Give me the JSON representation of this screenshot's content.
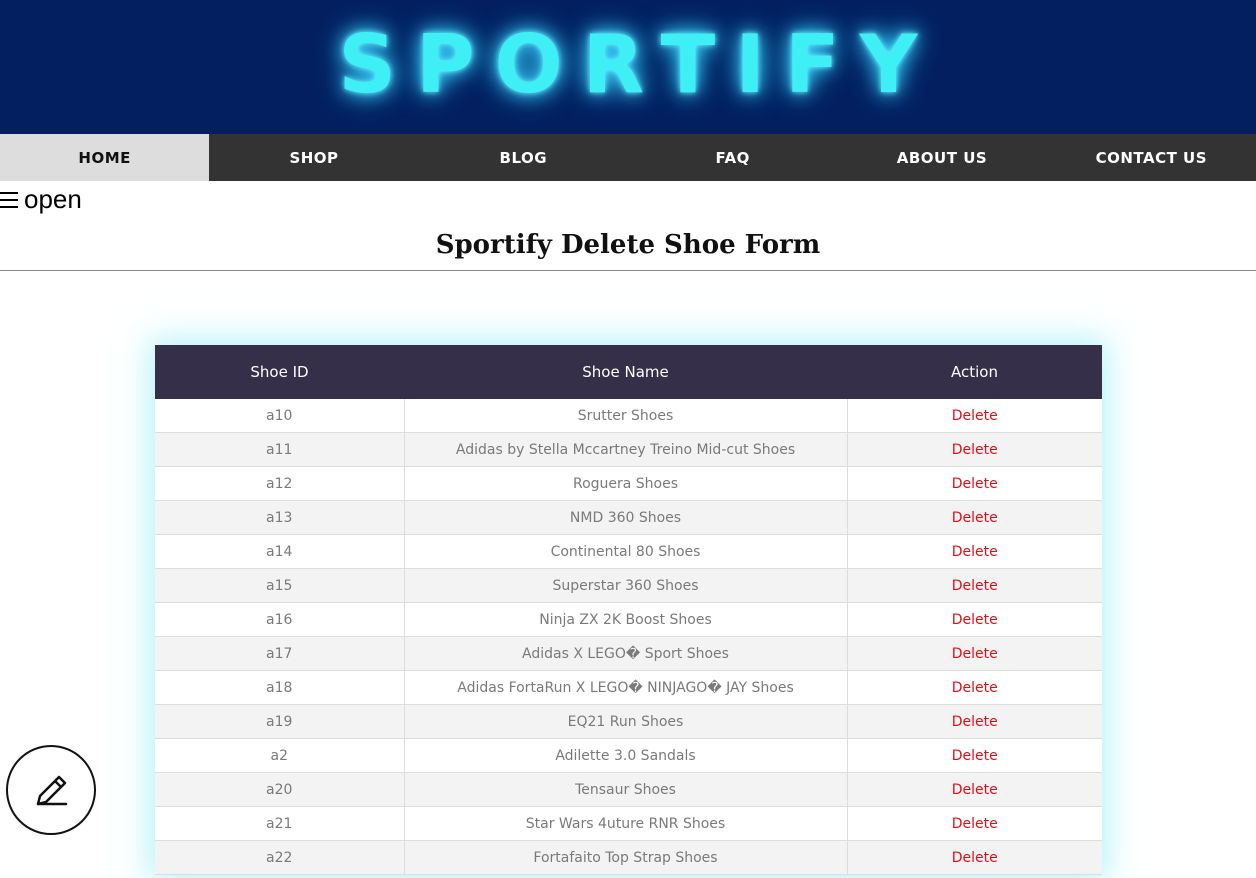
{
  "brand": {
    "logo_text": "SPORTIFY"
  },
  "nav": {
    "items": [
      {
        "label": "HOME",
        "active": true
      },
      {
        "label": "SHOP"
      },
      {
        "label": "BLOG"
      },
      {
        "label": "FAQ"
      },
      {
        "label": "ABOUT US"
      },
      {
        "label": "CONTACT US"
      }
    ]
  },
  "sidenav": {
    "toggle_label": "open",
    "icon": "hamburger-icon"
  },
  "page": {
    "title": "Sportify Delete Shoe Form"
  },
  "table": {
    "headers": [
      "Shoe ID",
      "Shoe Name",
      "Action"
    ],
    "rows": [
      {
        "id": "a10",
        "name": "Srutter Shoes",
        "action": "Delete"
      },
      {
        "id": "a11",
        "name": "Adidas by Stella Mccartney Treino Mid-cut Shoes",
        "action": "Delete"
      },
      {
        "id": "a12",
        "name": "Roguera Shoes",
        "action": "Delete"
      },
      {
        "id": "a13",
        "name": "NMD 360 Shoes",
        "action": "Delete"
      },
      {
        "id": "a14",
        "name": "Continental 80 Shoes",
        "action": "Delete"
      },
      {
        "id": "a15",
        "name": "Superstar 360 Shoes",
        "action": "Delete"
      },
      {
        "id": "a16",
        "name": "Ninja ZX 2K Boost Shoes",
        "action": "Delete"
      },
      {
        "id": "a17",
        "name": "Adidas X LEGO� Sport Shoes",
        "action": "Delete"
      },
      {
        "id": "a18",
        "name": "Adidas FortaRun X LEGO� NINJAGO� JAY Shoes",
        "action": "Delete"
      },
      {
        "id": "a19",
        "name": "EQ21 Run Shoes",
        "action": "Delete"
      },
      {
        "id": "a2",
        "name": "Adilette 3.0 Sandals",
        "action": "Delete"
      },
      {
        "id": "a20",
        "name": "Tensaur Shoes",
        "action": "Delete"
      },
      {
        "id": "a21",
        "name": "Star Wars 4uture RNR Shoes",
        "action": "Delete"
      },
      {
        "id": "a22",
        "name": "Fortafaito Top Strap Shoes",
        "action": "Delete"
      }
    ]
  },
  "fab": {
    "icon": "pencil-icon"
  },
  "colors": {
    "banner_bg": "#031f5f",
    "logo_glow": "#3ef0f5",
    "nav_bg": "#333333",
    "nav_active_bg": "#dddddd",
    "table_header_bg": "#352f4a",
    "delete_link": "#e0101a"
  }
}
